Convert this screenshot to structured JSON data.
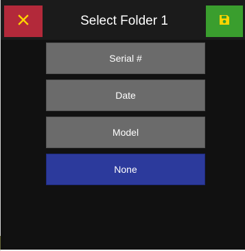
{
  "header": {
    "title": "Select Folder 1",
    "close_icon": "close-icon",
    "save_icon": "save-icon"
  },
  "options": [
    {
      "label": "Serial #",
      "selected": false
    },
    {
      "label": "Date",
      "selected": false
    },
    {
      "label": "Model",
      "selected": false
    },
    {
      "label": "None",
      "selected": true
    }
  ],
  "colors": {
    "close": "#b3293a",
    "save": "#3a9e2e",
    "option": "#6b6b6b",
    "selected": "#2c3a9c",
    "icon_close": "#ffd400",
    "icon_save": "#ffd400"
  }
}
